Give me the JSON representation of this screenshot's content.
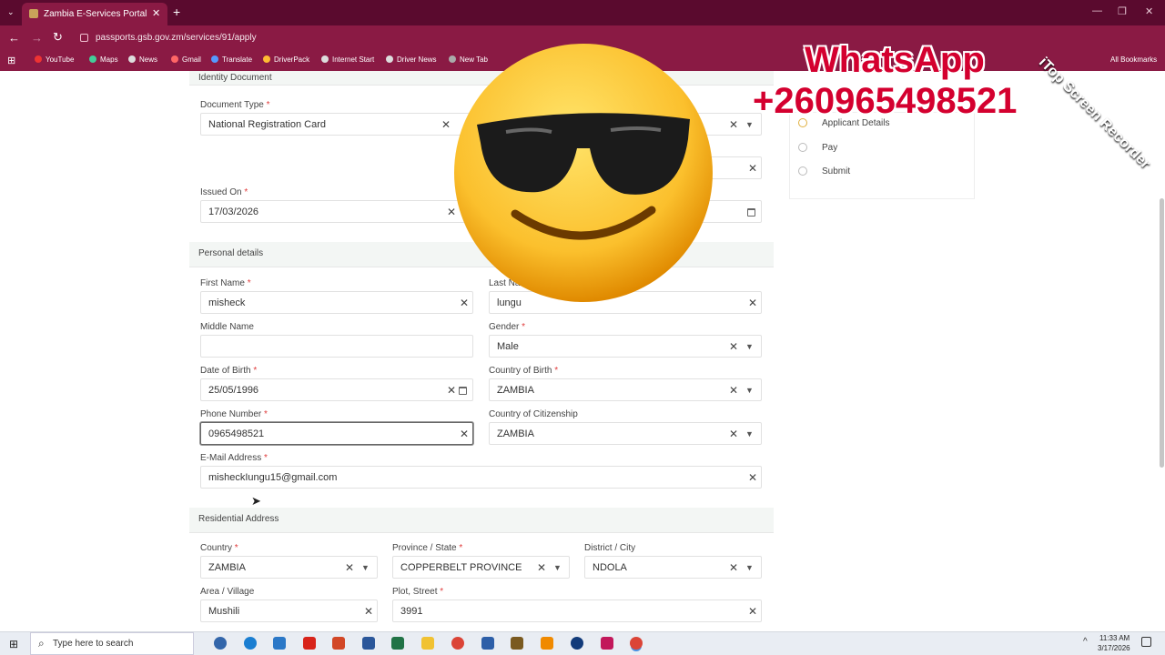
{
  "browser": {
    "tab_title": "Zambia E-Services Portal",
    "url": "passports.gsb.gov.zm/services/91/apply",
    "bookmarks": [
      "YouTube",
      "Maps",
      "News",
      "Gmail",
      "Translate",
      "DriverPack",
      "Internet Start",
      "Driver News",
      "New Tab"
    ],
    "all_bookmarks": "All Bookmarks"
  },
  "identity": {
    "heading": "Identity Document",
    "doc_type_label": "Document Type",
    "doc_type_value": "National Registration Card",
    "issued_label": "Issued On",
    "issued_value": "17/03/2026"
  },
  "personal": {
    "heading": "Personal details",
    "first_name_label": "First Name",
    "first_name": "misheck",
    "last_name_label": "Last Na",
    "last_name": "lungu",
    "middle_name_label": "Middle Name",
    "middle_name": "",
    "gender_label": "Gender",
    "gender": "Male",
    "dob_label": "Date of Birth",
    "dob": "25/05/1996",
    "cob_label": "Country of Birth",
    "cob": "ZAMBIA",
    "phone_label": "Phone Number",
    "phone": "0965498521",
    "citizenship_label": "Country of Citizenship",
    "citizenship": "ZAMBIA",
    "email_label": "E-Mail Address",
    "email": "misheckIungu15@gmail.com"
  },
  "residential": {
    "heading": "Residential Address",
    "country_label": "Country",
    "country": "ZAMBIA",
    "province_label": "Province / State",
    "province": "COPPERBELT PROVINCE",
    "district_label": "District / City",
    "district": "NDOLA",
    "area_label": "Area / Village",
    "area": "Mushili",
    "plot_label": "Plot, Street",
    "plot": "3991"
  },
  "steps": [
    "Applicant Details",
    "Pay",
    "Submit"
  ],
  "overlay": {
    "whatsapp": "WhatsApp",
    "phone": "+260965498521",
    "watermark": "iTop Screen Recorder"
  },
  "taskbar": {
    "search_placeholder": "Type here to search",
    "time": "11:33 AM",
    "date": "3/17/2026"
  },
  "colors": {
    "browser_frame": "#8a1a44",
    "required": "#e03c3c",
    "overlay_text": "#d4002f"
  }
}
